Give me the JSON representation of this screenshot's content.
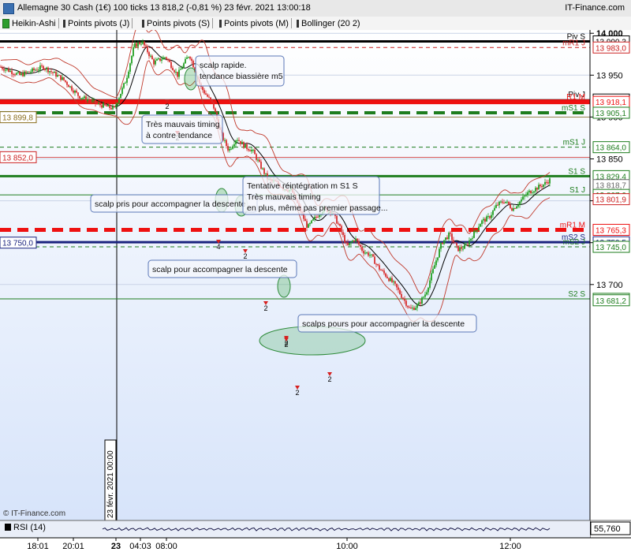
{
  "window": {
    "title": "Allemagne 30 Cash (1€) 100 ticks 13 818,2 (-0,81 %) 23 févr. 2021 13:00:18",
    "site": "IT-Finance.com"
  },
  "legend": [
    {
      "label": "Heikin-Ashi",
      "color": "#2e9e2e"
    },
    {
      "label": "Points pivots (J)",
      "color": "#333333"
    },
    {
      "label": "Points pivots (S)",
      "color": "#333333"
    },
    {
      "label": "Points pivots (M)",
      "color": "#333333"
    },
    {
      "label": "Bollinger (20 2)",
      "color": "#333333"
    }
  ],
  "watermark": "© IT-Finance.com",
  "rsi": {
    "label": "RSI (14)",
    "value": "55,760"
  },
  "separator_date": "23 févr. 2021 00:00",
  "chart_data": {
    "type": "candlestick",
    "instrument": "Allemagne 30 Cash (1€)",
    "ylim": [
      13660,
      14000
    ],
    "y_ticks": [
      "14 000",
      "13 950",
      "13 900",
      "13 850",
      "13 800",
      "13 750",
      "13 700"
    ],
    "x_ticks": [
      "18:01",
      "20:01",
      "23",
      "04:03",
      "08:00",
      "10:00",
      "12:00"
    ],
    "price_path": [
      [
        0,
        13960
      ],
      [
        25,
        13950
      ],
      [
        55,
        13960
      ],
      [
        80,
        13945
      ],
      [
        100,
        13925
      ],
      [
        125,
        13915
      ],
      [
        145,
        13910
      ],
      [
        160,
        13945
      ],
      [
        170,
        13985
      ],
      [
        180,
        13990
      ],
      [
        195,
        13965
      ],
      [
        210,
        13972
      ],
      [
        225,
        13950
      ],
      [
        240,
        13975
      ],
      [
        255,
        13935
      ],
      [
        270,
        13915
      ],
      [
        280,
        13880
      ],
      [
        290,
        13860
      ],
      [
        300,
        13875
      ],
      [
        310,
        13865
      ],
      [
        320,
        13860
      ],
      [
        330,
        13842
      ],
      [
        340,
        13825
      ],
      [
        350,
        13822
      ],
      [
        360,
        13815
      ],
      [
        370,
        13812
      ],
      [
        380,
        13790
      ],
      [
        390,
        13768
      ],
      [
        400,
        13780
      ],
      [
        410,
        13790
      ],
      [
        420,
        13788
      ],
      [
        430,
        13770
      ],
      [
        440,
        13745
      ],
      [
        450,
        13755
      ],
      [
        460,
        13740
      ],
      [
        470,
        13735
      ],
      [
        480,
        13720
      ],
      [
        490,
        13710
      ],
      [
        500,
        13700
      ],
      [
        510,
        13685
      ],
      [
        520,
        13670
      ],
      [
        530,
        13675
      ],
      [
        540,
        13690
      ],
      [
        550,
        13720
      ],
      [
        560,
        13750
      ],
      [
        570,
        13760
      ],
      [
        580,
        13742
      ],
      [
        590,
        13745
      ],
      [
        600,
        13760
      ],
      [
        610,
        13775
      ],
      [
        620,
        13780
      ],
      [
        630,
        13795
      ],
      [
        640,
        13800
      ],
      [
        650,
        13790
      ],
      [
        660,
        13800
      ],
      [
        670,
        13810
      ],
      [
        680,
        13815
      ],
      [
        690,
        13820
      ],
      [
        697,
        13825
      ]
    ],
    "levels": [
      {
        "label": "Piv S",
        "value": "13 990,3",
        "price": 13990.3,
        "color": "#000000",
        "style": "solid",
        "width": 3
      },
      {
        "label": "mR1 J",
        "value": "13 983,0",
        "price": 13983.0,
        "color": "#cc2222",
        "style": "dashed",
        "width": 1
      },
      {
        "label": "Piv J",
        "value": "13 920,9",
        "price": 13920.9,
        "color": "#000000",
        "style": "solid",
        "width": 1
      },
      {
        "label": "R1 M",
        "value": "13 918,1",
        "price": 13918.1,
        "color": "#ee1111",
        "style": "solid",
        "width": 6
      },
      {
        "label": "mS1 S",
        "value": "13 905,1",
        "price": 13905.1,
        "color": "#1e7d1e",
        "style": "dashed",
        "width": 4
      },
      {
        "label": "mS1 J",
        "value": "13 864,0",
        "price": 13864.0,
        "color": "#1e7d1e",
        "style": "dashed",
        "width": 1
      },
      {
        "label": "S1 S",
        "value": "13 829,4",
        "price": 13829.4,
        "color": "#1e7d1e",
        "style": "solid",
        "width": 3
      },
      {
        "label": "",
        "value": "13 818,7",
        "price": 13818.7,
        "color": "#666666",
        "style": "none",
        "width": 0
      },
      {
        "label": "S1 J",
        "value": "13 807,0",
        "price": 13807.0,
        "color": "#1e7d1e",
        "style": "solid",
        "width": 1
      },
      {
        "label": "",
        "value": "13 801,9",
        "price": 13801.9,
        "color": "#cc2222",
        "style": "none",
        "width": 0
      },
      {
        "label": "mR1 M",
        "value": "13 765,3",
        "price": 13765.3,
        "color": "#ee1111",
        "style": "dashed",
        "width": 5
      },
      {
        "label": "mS2 S",
        "value": "13 750,5",
        "price": 13750.5,
        "color": "#1a237e",
        "style": "solid",
        "width": 3
      },
      {
        "label": "mS2 J",
        "value": "13 745,0",
        "price": 13745.0,
        "color": "#1e7d1e",
        "style": "dashed",
        "width": 1
      },
      {
        "label": "S2 S",
        "value": "13 682,9",
        "price": 13682.9,
        "color": "#1e7d1e",
        "style": "solid",
        "width": 1
      },
      {
        "label": "",
        "value": "13 681,2",
        "price": 13681.2,
        "color": "#1e7d1e",
        "style": "none",
        "width": 0
      }
    ],
    "left_price_boxes": [
      {
        "value": "13 899,8",
        "price": 13899.8,
        "color": "#8a6d1e"
      },
      {
        "value": "13 852,0",
        "price": 13852.0,
        "color": "#cc2222"
      },
      {
        "value": "13 750,0",
        "price": 13750.0,
        "color": "#1a237e"
      }
    ],
    "annotations": [
      "scalp rapide.\ntendance biassière m5",
      "Très mauvais timing\nà contre tendance",
      "scalp pris pour accompagner la descente",
      "Tentative réintégration m S1 S\nTrès mauvais timing\nen plus, même pas premier passage...",
      "scalp pour accompagner la descente",
      "scalps pours pour accompagner la descente"
    ],
    "trade_markers": [
      "2",
      "2",
      "2",
      "4",
      "2",
      "2",
      "2",
      "2",
      "2"
    ]
  }
}
